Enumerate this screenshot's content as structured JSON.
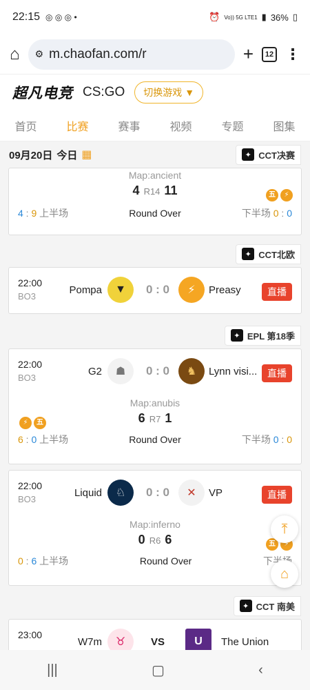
{
  "status": {
    "time": "22:15",
    "signal": "Vo)) 5G LTE1",
    "battery": "36%"
  },
  "browser": {
    "url": "m.chaofan.com/r",
    "tab_count": "12"
  },
  "site": {
    "logo": "超凡电竞",
    "game": "CS:GO",
    "switch_label": "切换游戏"
  },
  "nav": {
    "tabs": [
      "首页",
      "比赛",
      "赛事",
      "视频",
      "专题",
      "图集"
    ],
    "active": 1
  },
  "date_header": {
    "date": "09月20日",
    "today": "今日"
  },
  "leagues": [
    "CCT决赛",
    "CCT北欧",
    "EPL 第18季",
    "CCT 南美"
  ],
  "match0": {
    "map": "Map:ancient",
    "left_score": "4",
    "round": "R14",
    "right_score": "11",
    "left_half": "4",
    "left_half2": "9",
    "half_label": "上半场",
    "status": "Round Over",
    "right_half_label": "下半场",
    "right_half": "0",
    "right_half2": "0",
    "badge1": "五",
    "badge2": "⚡"
  },
  "match1": {
    "time": "22:00",
    "bo": "BO3",
    "team1": "Pompa",
    "team2": "Preasy",
    "score": "0 : 0",
    "live": "直播"
  },
  "match2": {
    "time": "22:00",
    "bo": "BO3",
    "team1": "G2",
    "team2": "Lynn visi...",
    "score": "0 : 0",
    "live": "直播",
    "map": "Map:anubis",
    "left_score": "6",
    "round": "R7",
    "right_score": "1",
    "left_half": "6",
    "left_half2": "0",
    "half_label": "上半场",
    "status": "Round Over",
    "right_half_label": "下半场",
    "right_half": "0",
    "right_half2": "0",
    "badge1": "⚡",
    "badge2": "五"
  },
  "match3": {
    "time": "22:00",
    "bo": "BO3",
    "team1": "Liquid",
    "team2": "VP",
    "score": "0 : 0",
    "live": "直播",
    "map": "Map:inferno",
    "left_score": "0",
    "round": "R6",
    "right_score": "6",
    "left_half": "0",
    "left_half2": "6",
    "half_label": "上半场",
    "status": "Round Over",
    "right_half_label": "下半场",
    "badge1": "五",
    "badge2": "⚡"
  },
  "match4": {
    "time": "23:00",
    "team1": "W7m",
    "vs": "VS",
    "team2": "The Union"
  }
}
